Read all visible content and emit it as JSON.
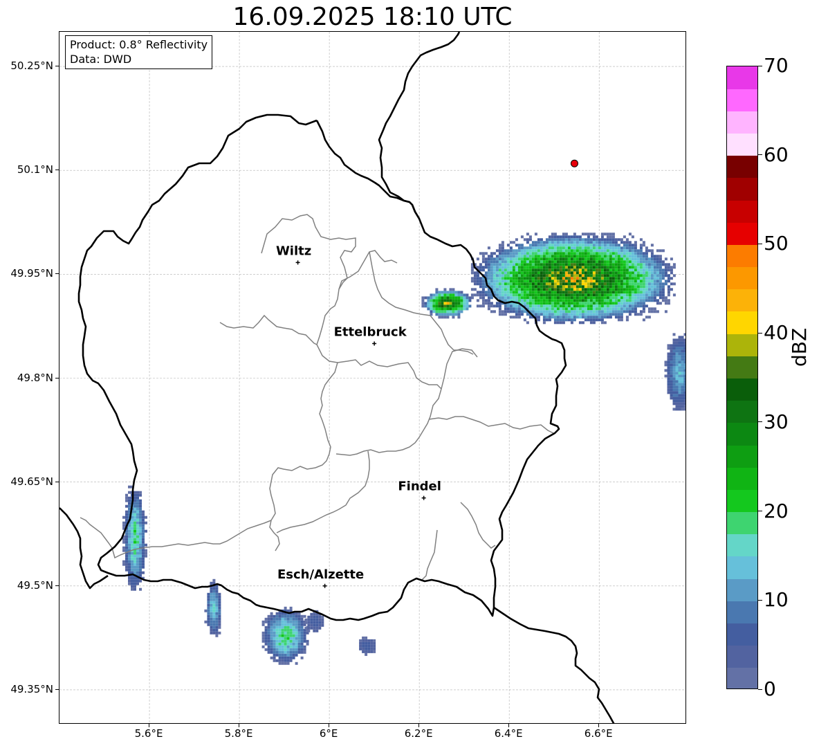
{
  "title": "16.09.2025 18:10 UTC",
  "info_box": {
    "product": "Product: 0.8° Reflectivity",
    "source": "Data: DWD"
  },
  "map": {
    "extent": {
      "lon_min": 5.4,
      "lon_max": 6.795,
      "lat_min": 49.3,
      "lat_max": 50.3
    },
    "lat_ticks": [
      {
        "value": 50.25,
        "label": "50.25°N"
      },
      {
        "value": 50.1,
        "label": "50.1°N"
      },
      {
        "value": 49.95,
        "label": "49.95°N"
      },
      {
        "value": 49.8,
        "label": "49.8°N"
      },
      {
        "value": 49.65,
        "label": "49.65°N"
      },
      {
        "value": 49.5,
        "label": "49.5°N"
      },
      {
        "value": 49.35,
        "label": "49.35°N"
      }
    ],
    "lon_ticks": [
      {
        "value": 5.6,
        "label": "5.6°E"
      },
      {
        "value": 5.8,
        "label": "5.8°E"
      },
      {
        "value": 6.0,
        "label": "6°E"
      },
      {
        "value": 6.2,
        "label": "6.2°E"
      },
      {
        "value": 6.4,
        "label": "6.4°E"
      },
      {
        "value": 6.6,
        "label": "6.6°E"
      }
    ],
    "grid": true,
    "cities": [
      {
        "name": "Wiltz",
        "lon": 5.93,
        "lat": 49.967
      },
      {
        "name": "Ettelbruck",
        "lon": 6.1,
        "lat": 49.85
      },
      {
        "name": "Findel",
        "lon": 6.21,
        "lat": 49.627
      },
      {
        "name": "Esch/Alzette",
        "lon": 5.99,
        "lat": 49.5
      }
    ],
    "marker": {
      "lon": 6.545,
      "lat": 50.11,
      "color": "#e8000b"
    },
    "border_colors": {
      "national": "#000000",
      "cantonal": "#808080"
    },
    "precipitation_cells": [
      {
        "name": "cell-ne-main",
        "lon": 6.54,
        "lat": 49.945,
        "rx": 0.225,
        "ry": 0.065,
        "max_dbz": 46
      },
      {
        "name": "cell-ne-tail",
        "lon": 6.26,
        "lat": 49.91,
        "rx": 0.055,
        "ry": 0.02,
        "max_dbz": 44
      },
      {
        "name": "cell-east-edge",
        "lon": 6.775,
        "lat": 49.81,
        "rx": 0.03,
        "ry": 0.055,
        "max_dbz": 16
      },
      {
        "name": "cell-sw-west",
        "lon": 5.565,
        "lat": 49.57,
        "rx": 0.025,
        "ry": 0.075,
        "max_dbz": 22
      },
      {
        "name": "cell-south-1",
        "lon": 5.74,
        "lat": 49.47,
        "rx": 0.018,
        "ry": 0.04,
        "max_dbz": 18
      },
      {
        "name": "cell-south-2",
        "lon": 5.9,
        "lat": 49.43,
        "rx": 0.05,
        "ry": 0.04,
        "max_dbz": 24
      },
      {
        "name": "cell-south-3",
        "lon": 5.965,
        "lat": 49.45,
        "rx": 0.02,
        "ry": 0.015,
        "max_dbz": 8
      },
      {
        "name": "cell-south-4",
        "lon": 6.08,
        "lat": 49.415,
        "rx": 0.02,
        "ry": 0.012,
        "max_dbz": 8
      }
    ]
  },
  "colorbar": {
    "label": "dBZ",
    "min": 0,
    "max": 70,
    "ticks": [
      {
        "value": 0,
        "label": "0"
      },
      {
        "value": 10,
        "label": "10"
      },
      {
        "value": 20,
        "label": "20"
      },
      {
        "value": 30,
        "label": "30"
      },
      {
        "value": 40,
        "label": "40"
      },
      {
        "value": 50,
        "label": "50"
      },
      {
        "value": 60,
        "label": "60"
      },
      {
        "value": 70,
        "label": "70"
      }
    ],
    "colors": [
      "#6371a6",
      "#5263a0",
      "#445ea0",
      "#4a78b0",
      "#5a9bc6",
      "#66c0da",
      "#64d6c8",
      "#3ed470",
      "#14c81e",
      "#10b414",
      "#0e9e12",
      "#0c8812",
      "#0e7412",
      "#0a5e0a",
      "#447a14",
      "#acb40a",
      "#ffd600",
      "#fcb208",
      "#fc9800",
      "#fc7c00",
      "#e60000",
      "#c80000",
      "#a00000",
      "#780000",
      "#ffe0ff",
      "#ffb4ff",
      "#ff68ff",
      "#e838e8"
    ]
  }
}
